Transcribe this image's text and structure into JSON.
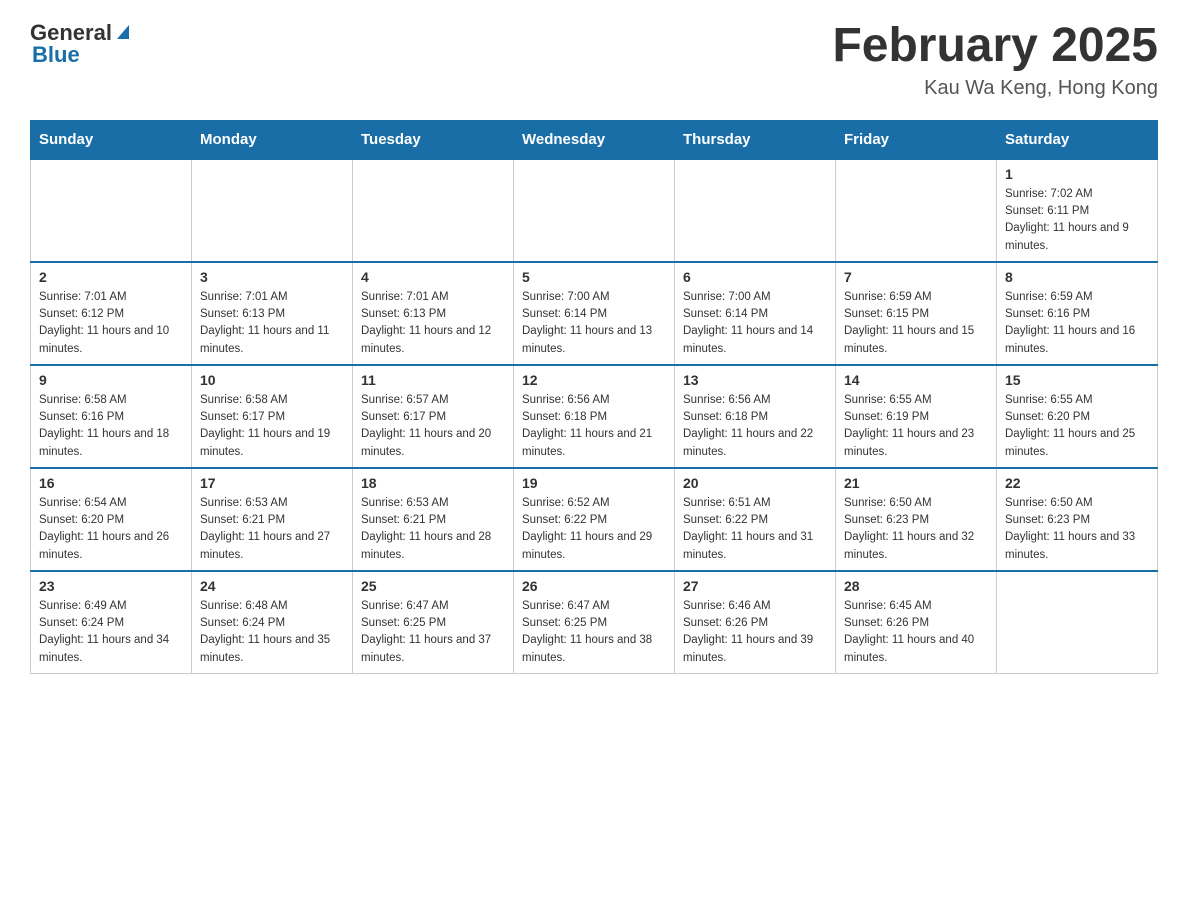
{
  "header": {
    "logo_general": "General",
    "logo_blue": "Blue",
    "month_title": "February 2025",
    "location": "Kau Wa Keng, Hong Kong"
  },
  "days_of_week": [
    "Sunday",
    "Monday",
    "Tuesday",
    "Wednesday",
    "Thursday",
    "Friday",
    "Saturday"
  ],
  "weeks": [
    {
      "cells": [
        {
          "empty": true
        },
        {
          "empty": true
        },
        {
          "empty": true
        },
        {
          "empty": true
        },
        {
          "empty": true
        },
        {
          "empty": true
        },
        {
          "day": "1",
          "sunrise": "Sunrise: 7:02 AM",
          "sunset": "Sunset: 6:11 PM",
          "daylight": "Daylight: 11 hours and 9 minutes."
        }
      ]
    },
    {
      "cells": [
        {
          "day": "2",
          "sunrise": "Sunrise: 7:01 AM",
          "sunset": "Sunset: 6:12 PM",
          "daylight": "Daylight: 11 hours and 10 minutes."
        },
        {
          "day": "3",
          "sunrise": "Sunrise: 7:01 AM",
          "sunset": "Sunset: 6:13 PM",
          "daylight": "Daylight: 11 hours and 11 minutes."
        },
        {
          "day": "4",
          "sunrise": "Sunrise: 7:01 AM",
          "sunset": "Sunset: 6:13 PM",
          "daylight": "Daylight: 11 hours and 12 minutes."
        },
        {
          "day": "5",
          "sunrise": "Sunrise: 7:00 AM",
          "sunset": "Sunset: 6:14 PM",
          "daylight": "Daylight: 11 hours and 13 minutes."
        },
        {
          "day": "6",
          "sunrise": "Sunrise: 7:00 AM",
          "sunset": "Sunset: 6:14 PM",
          "daylight": "Daylight: 11 hours and 14 minutes."
        },
        {
          "day": "7",
          "sunrise": "Sunrise: 6:59 AM",
          "sunset": "Sunset: 6:15 PM",
          "daylight": "Daylight: 11 hours and 15 minutes."
        },
        {
          "day": "8",
          "sunrise": "Sunrise: 6:59 AM",
          "sunset": "Sunset: 6:16 PM",
          "daylight": "Daylight: 11 hours and 16 minutes."
        }
      ]
    },
    {
      "cells": [
        {
          "day": "9",
          "sunrise": "Sunrise: 6:58 AM",
          "sunset": "Sunset: 6:16 PM",
          "daylight": "Daylight: 11 hours and 18 minutes."
        },
        {
          "day": "10",
          "sunrise": "Sunrise: 6:58 AM",
          "sunset": "Sunset: 6:17 PM",
          "daylight": "Daylight: 11 hours and 19 minutes."
        },
        {
          "day": "11",
          "sunrise": "Sunrise: 6:57 AM",
          "sunset": "Sunset: 6:17 PM",
          "daylight": "Daylight: 11 hours and 20 minutes."
        },
        {
          "day": "12",
          "sunrise": "Sunrise: 6:56 AM",
          "sunset": "Sunset: 6:18 PM",
          "daylight": "Daylight: 11 hours and 21 minutes."
        },
        {
          "day": "13",
          "sunrise": "Sunrise: 6:56 AM",
          "sunset": "Sunset: 6:18 PM",
          "daylight": "Daylight: 11 hours and 22 minutes."
        },
        {
          "day": "14",
          "sunrise": "Sunrise: 6:55 AM",
          "sunset": "Sunset: 6:19 PM",
          "daylight": "Daylight: 11 hours and 23 minutes."
        },
        {
          "day": "15",
          "sunrise": "Sunrise: 6:55 AM",
          "sunset": "Sunset: 6:20 PM",
          "daylight": "Daylight: 11 hours and 25 minutes."
        }
      ]
    },
    {
      "cells": [
        {
          "day": "16",
          "sunrise": "Sunrise: 6:54 AM",
          "sunset": "Sunset: 6:20 PM",
          "daylight": "Daylight: 11 hours and 26 minutes."
        },
        {
          "day": "17",
          "sunrise": "Sunrise: 6:53 AM",
          "sunset": "Sunset: 6:21 PM",
          "daylight": "Daylight: 11 hours and 27 minutes."
        },
        {
          "day": "18",
          "sunrise": "Sunrise: 6:53 AM",
          "sunset": "Sunset: 6:21 PM",
          "daylight": "Daylight: 11 hours and 28 minutes."
        },
        {
          "day": "19",
          "sunrise": "Sunrise: 6:52 AM",
          "sunset": "Sunset: 6:22 PM",
          "daylight": "Daylight: 11 hours and 29 minutes."
        },
        {
          "day": "20",
          "sunrise": "Sunrise: 6:51 AM",
          "sunset": "Sunset: 6:22 PM",
          "daylight": "Daylight: 11 hours and 31 minutes."
        },
        {
          "day": "21",
          "sunrise": "Sunrise: 6:50 AM",
          "sunset": "Sunset: 6:23 PM",
          "daylight": "Daylight: 11 hours and 32 minutes."
        },
        {
          "day": "22",
          "sunrise": "Sunrise: 6:50 AM",
          "sunset": "Sunset: 6:23 PM",
          "daylight": "Daylight: 11 hours and 33 minutes."
        }
      ]
    },
    {
      "cells": [
        {
          "day": "23",
          "sunrise": "Sunrise: 6:49 AM",
          "sunset": "Sunset: 6:24 PM",
          "daylight": "Daylight: 11 hours and 34 minutes."
        },
        {
          "day": "24",
          "sunrise": "Sunrise: 6:48 AM",
          "sunset": "Sunset: 6:24 PM",
          "daylight": "Daylight: 11 hours and 35 minutes."
        },
        {
          "day": "25",
          "sunrise": "Sunrise: 6:47 AM",
          "sunset": "Sunset: 6:25 PM",
          "daylight": "Daylight: 11 hours and 37 minutes."
        },
        {
          "day": "26",
          "sunrise": "Sunrise: 6:47 AM",
          "sunset": "Sunset: 6:25 PM",
          "daylight": "Daylight: 11 hours and 38 minutes."
        },
        {
          "day": "27",
          "sunrise": "Sunrise: 6:46 AM",
          "sunset": "Sunset: 6:26 PM",
          "daylight": "Daylight: 11 hours and 39 minutes."
        },
        {
          "day": "28",
          "sunrise": "Sunrise: 6:45 AM",
          "sunset": "Sunset: 6:26 PM",
          "daylight": "Daylight: 11 hours and 40 minutes."
        },
        {
          "empty": true
        }
      ]
    }
  ]
}
